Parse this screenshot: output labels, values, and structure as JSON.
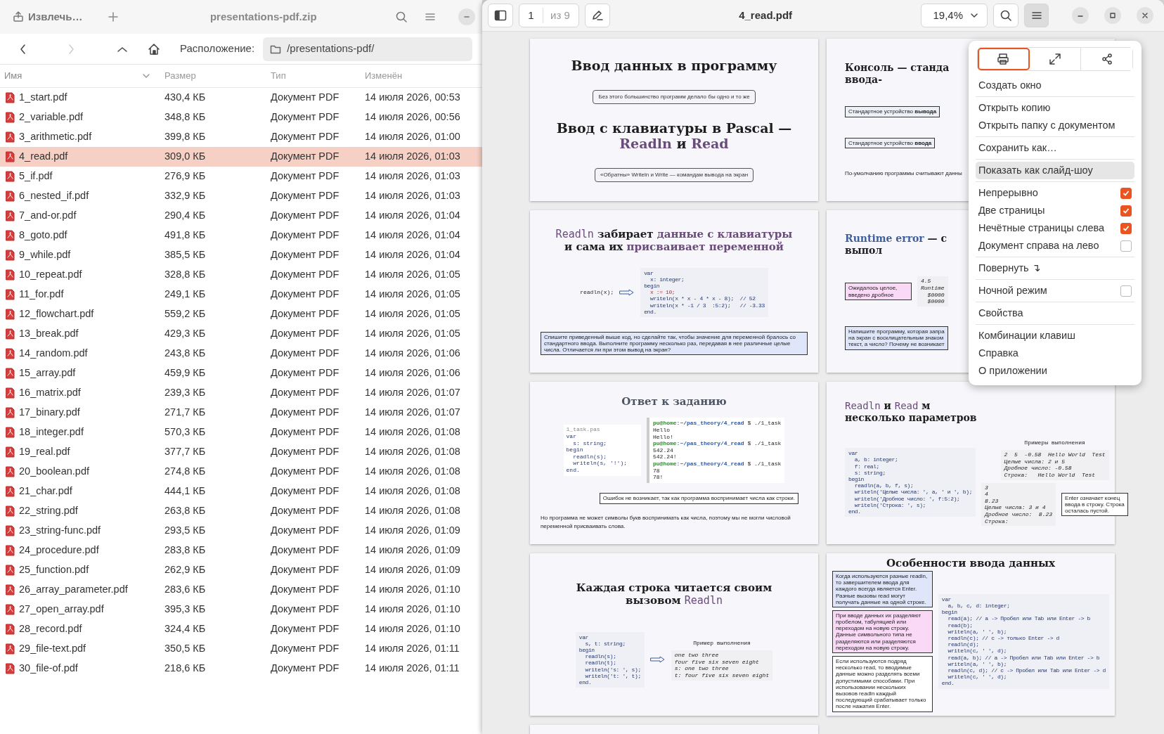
{
  "archive_window": {
    "extract_button": "Извлечь…",
    "title": "presentations-pdf.zip",
    "nav": {
      "back_disabled": false,
      "forward_disabled": true
    },
    "location_label": "Расположение:",
    "location_path": "/presentations-pdf/",
    "columns": [
      {
        "label": "Имя",
        "sorted": true
      },
      {
        "label": "Размер",
        "sorted": false
      },
      {
        "label": "Тип",
        "sorted": false
      },
      {
        "label": "Изменён",
        "sorted": false
      }
    ],
    "files": [
      {
        "name": "1_start.pdf",
        "size": "430,4 КБ",
        "type": "Документ PDF",
        "modified": "14 июля 2026, 00:53",
        "selected": false
      },
      {
        "name": "2_variable.pdf",
        "size": "348,8 КБ",
        "type": "Документ PDF",
        "modified": "14 июля 2026, 00:56",
        "selected": false
      },
      {
        "name": "3_arithmetic.pdf",
        "size": "399,8 КБ",
        "type": "Документ PDF",
        "modified": "14 июля 2026, 01:00",
        "selected": false
      },
      {
        "name": "4_read.pdf",
        "size": "309,0 КБ",
        "type": "Документ PDF",
        "modified": "14 июля 2026, 01:03",
        "selected": true
      },
      {
        "name": "5_if.pdf",
        "size": "276,9 КБ",
        "type": "Документ PDF",
        "modified": "14 июля 2026, 01:03",
        "selected": false
      },
      {
        "name": "6_nested_if.pdf",
        "size": "332,9 КБ",
        "type": "Документ PDF",
        "modified": "14 июля 2026, 01:03",
        "selected": false
      },
      {
        "name": "7_and-or.pdf",
        "size": "290,4 КБ",
        "type": "Документ PDF",
        "modified": "14 июля 2026, 01:04",
        "selected": false
      },
      {
        "name": "8_goto.pdf",
        "size": "491,8 КБ",
        "type": "Документ PDF",
        "modified": "14 июля 2026, 01:04",
        "selected": false
      },
      {
        "name": "9_while.pdf",
        "size": "385,5 КБ",
        "type": "Документ PDF",
        "modified": "14 июля 2026, 01:04",
        "selected": false
      },
      {
        "name": "10_repeat.pdf",
        "size": "328,8 КБ",
        "type": "Документ PDF",
        "modified": "14 июля 2026, 01:05",
        "selected": false
      },
      {
        "name": "11_for.pdf",
        "size": "249,1 КБ",
        "type": "Документ PDF",
        "modified": "14 июля 2026, 01:05",
        "selected": false
      },
      {
        "name": "12_flowchart.pdf",
        "size": "559,2 КБ",
        "type": "Документ PDF",
        "modified": "14 июля 2026, 01:05",
        "selected": false
      },
      {
        "name": "13_break.pdf",
        "size": "429,3 КБ",
        "type": "Документ PDF",
        "modified": "14 июля 2026, 01:05",
        "selected": false
      },
      {
        "name": "14_random.pdf",
        "size": "243,8 КБ",
        "type": "Документ PDF",
        "modified": "14 июля 2026, 01:06",
        "selected": false
      },
      {
        "name": "15_array.pdf",
        "size": "459,9 КБ",
        "type": "Документ PDF",
        "modified": "14 июля 2026, 01:06",
        "selected": false
      },
      {
        "name": "16_matrix.pdf",
        "size": "239,3 КБ",
        "type": "Документ PDF",
        "modified": "14 июля 2026, 01:07",
        "selected": false
      },
      {
        "name": "17_binary.pdf",
        "size": "271,7 КБ",
        "type": "Документ PDF",
        "modified": "14 июля 2026, 01:07",
        "selected": false
      },
      {
        "name": "18_integer.pdf",
        "size": "570,3 КБ",
        "type": "Документ PDF",
        "modified": "14 июля 2026, 01:08",
        "selected": false
      },
      {
        "name": "19_real.pdf",
        "size": "377,7 КБ",
        "type": "Документ PDF",
        "modified": "14 июля 2026, 01:08",
        "selected": false
      },
      {
        "name": "20_boolean.pdf",
        "size": "274,8 КБ",
        "type": "Документ PDF",
        "modified": "14 июля 2026, 01:08",
        "selected": false
      },
      {
        "name": "21_char.pdf",
        "size": "444,1 КБ",
        "type": "Документ PDF",
        "modified": "14 июля 2026, 01:08",
        "selected": false
      },
      {
        "name": "22_string.pdf",
        "size": "263,8 КБ",
        "type": "Документ PDF",
        "modified": "14 июля 2026, 01:08",
        "selected": false
      },
      {
        "name": "23_string-func.pdf",
        "size": "293,5 КБ",
        "type": "Документ PDF",
        "modified": "14 июля 2026, 01:09",
        "selected": false
      },
      {
        "name": "24_procedure.pdf",
        "size": "283,8 КБ",
        "type": "Документ PDF",
        "modified": "14 июля 2026, 01:09",
        "selected": false
      },
      {
        "name": "25_function.pdf",
        "size": "262,9 КБ",
        "type": "Документ PDF",
        "modified": "14 июля 2026, 01:09",
        "selected": false
      },
      {
        "name": "26_array_parameter.pdf",
        "size": "283,6 КБ",
        "type": "Документ PDF",
        "modified": "14 июля 2026, 01:10",
        "selected": false
      },
      {
        "name": "27_open_array.pdf",
        "size": "395,3 КБ",
        "type": "Документ PDF",
        "modified": "14 июля 2026, 01:10",
        "selected": false
      },
      {
        "name": "28_record.pdf",
        "size": "324,4 КБ",
        "type": "Документ PDF",
        "modified": "14 июля 2026, 01:10",
        "selected": false
      },
      {
        "name": "29_file-text.pdf",
        "size": "350,5 КБ",
        "type": "Документ PDF",
        "modified": "14 июля 2026, 01:11",
        "selected": false
      },
      {
        "name": "30_file-of.pdf",
        "size": "218,6 КБ",
        "type": "Документ PDF",
        "modified": "14 июля 2026, 01:11",
        "selected": false
      }
    ]
  },
  "viewer_window": {
    "page_number": "1",
    "page_count": "из 9",
    "title": "4_read.pdf",
    "zoom": "19,4%",
    "pages": [
      {
        "items": [
          {
            "kind": "heading",
            "lines": [
              [
                {
                  "text": "Ввод данных в программу"
                }
              ]
            ]
          },
          {
            "kind": "note",
            "text": "Без этого большинство программ делало бы одно и то же"
          },
          {
            "kind": "heading",
            "lines": [
              [
                {
                  "text": "Ввод с клавиатуры в Pascal —"
                }
              ],
              [
                {
                  "text": "Readln",
                  "color": "#6b4b7c"
                },
                {
                  "text": " и "
                },
                {
                  "text": "Read",
                  "color": "#6b4b7c"
                }
              ]
            ]
          },
          {
            "kind": "note",
            "text": "«Обратны» Writeln и Write — командам вывода на экран"
          }
        ]
      },
      {
        "items": [
          {
            "kind": "title",
            "lines": [
              [
                {
                  "text": "Консоль — станда"
                }
              ],
              [
                {
                  "text": "ввода-"
                }
              ]
            ]
          },
          {
            "kind": "box",
            "color": "#eef0f8",
            "text": "Стандартное устройство **вывода**"
          },
          {
            "kind": "box",
            "color": "#eef0f8",
            "text": "Стандартное устройство **ввода**"
          },
          {
            "kind": "text",
            "text": "По-умолчанию программы считывают данны"
          }
        ]
      },
      {
        "items": [
          {
            "kind": "title",
            "lines": [
              [
                {
                  "text": "Readln",
                  "color": "#6b4b7c",
                  "mono": true
                },
                {
                  "text": " забирает "
                },
                {
                  "text": "данные с клавиатуры",
                  "color": "#6b4b7c"
                }
              ],
              [
                {
                  "text": "и сама их "
                },
                {
                  "text": "присваивает переменной",
                  "color": "#6b4b7c"
                }
              ]
            ]
          },
          {
            "kind": "columns",
            "columns": [
              [
                {
                  "kind": "label",
                  "text": "readln(x);"
                }
              ],
              [
                {
                  "kind": "arrow"
                }
              ],
              [
                {
                  "kind": "code",
                  "lines": [
                    "var",
                    "  x: integer;",
                    "begin",
                    {
                      "text": "  x := 10;",
                      "struck": true
                    },
                    "  writeln(x * x - 4 * x - 8);  // 52",
                    "  writeln(x * -1 / 3  :5:2);   // -3.33",
                    "end."
                  ]
                }
              ]
            ]
          },
          {
            "kind": "box",
            "color": "#dfe6fa",
            "text": "Спишите приведенный выше код, но сделайте так, чтобы значение для переменной бралось со стандартного ввода. Выполните программу несколько раз, передавая в нее различные целые числа. Отличается ли при этом вывод на экран?"
          }
        ]
      },
      {
        "items": [
          {
            "kind": "title",
            "lines": [
              [
                {
                  "text": "Runtime error",
                  "color": "#40609a"
                },
                {
                  "text": " — с"
                }
              ],
              [
                {
                  "text": "выпол"
                }
              ]
            ]
          },
          {
            "kind": "columns",
            "columns": [
              [
                {
                  "kind": "box",
                  "color": "#f9d9f6",
                  "text": "Ожидалось целое, введено дробное"
                }
              ],
              [
                {
                  "kind": "output",
                  "lines": [
                    "4.5",
                    "Runtime",
                    "  $0000",
                    "  $0000"
                  ]
                }
              ]
            ]
          },
          {
            "kind": "box",
            "color": "#dfe6fa",
            "lines": [
              "Напишите программу, которая запра",
              "на экран с восклицательным знаком",
              "текст, а число? Почему не возникает"
            ]
          }
        ]
      },
      {
        "items": [
          {
            "kind": "title",
            "lines": [
              [
                {
                  "text": "Ответ к заданию",
                  "color": "#4d5563"
                }
              ]
            ]
          },
          {
            "kind": "columns",
            "columns": [
              [
                {
                  "kind": "editor",
                  "tab": "1_task.pas",
                  "lines": [
                    "var",
                    "  s: string;",
                    "begin",
                    "  readln(s);",
                    "  writeln(s, '!');",
                    "end."
                  ]
                }
              ],
              [
                {
                  "kind": "terminal",
                  "lines": [
                    {
                      "kind": "prompt",
                      "host": "pu@home",
                      "path": ":~/pas_theory/4_read",
                      "command": "$ ./1_task"
                    },
                    "Hello",
                    "Hello!",
                    {
                      "kind": "prompt",
                      "host": "pu@home",
                      "path": ":~/pas_theory/4_read",
                      "command": "$ ./1_task"
                    },
                    "542.24",
                    "542.24!",
                    {
                      "kind": "prompt",
                      "host": "pu@home",
                      "path": ":~/pas_theory/4_read",
                      "command": "$ ./1_task"
                    },
                    "78",
                    "78!"
                  ]
                }
              ]
            ]
          },
          {
            "kind": "callout",
            "color": "#ffffff",
            "text": "Ошибок не возникает, так как программа воспринимает числа как строки."
          },
          {
            "kind": "text",
            "text": "Но программа не может символы букв воспринимать как числа, поэтому мы не могли числовой переменной присваивать слова."
          }
        ]
      },
      {
        "items": [
          {
            "kind": "title",
            "lines": [
              [
                {
                  "text": "Readln",
                  "color": "#6b4b7c",
                  "mono": true
                },
                {
                  "text": " и "
                },
                {
                  "text": "Read",
                  "color": "#6b4b7c",
                  "mono": true
                },
                {
                  "text": " м"
                }
              ],
              [
                {
                  "text": "несколько параметров"
                }
              ]
            ]
          },
          {
            "kind": "columns",
            "columns": [
              [
                {
                  "kind": "code",
                  "lines": [
                    "var",
                    "  a, b: integer;",
                    "  f: real;",
                    "  s: string;",
                    "begin",
                    "  readln(a, b, f, s);",
                    "  writeln('Целые числа: ', a, ' и ', b);",
                    "  writeln('Дробное число: ', f:5:2);",
                    "  writeln('Строка: ', s);",
                    "end."
                  ]
                }
              ],
              [
                {
                  "kind": "label",
                  "text": "Примеры выполнения"
                },
                {
                  "kind": "output",
                  "lines": [
                    "2  5  -0.58  Hello World  Test",
                    "Целые числа: 2 и 5",
                    "Дробное число: -0.58",
                    "Строка:   Hello World  Test"
                  ]
                },
                {
                  "kind": "columns",
                  "columns": [
                    [
                      {
                        "kind": "output",
                        "lines": [
                          "3",
                          "4",
                          "8.23",
                          "Целые числа: 3 и 4",
                          "Дробное число:  8.23",
                          "Строка:"
                        ]
                      }
                    ],
                    [
                      {
                        "kind": "box",
                        "color": "#ffffff",
                        "text": "Enter означает конец ввода в строку. Строка осталась пустой."
                      }
                    ]
                  ]
                }
              ]
            ]
          }
        ]
      },
      {
        "items": [
          {
            "kind": "title",
            "lines": [
              [
                {
                  "text": "Каждая строка читается своим"
                }
              ],
              [
                {
                  "text": "вызовом "
                },
                {
                  "text": "Readln",
                  "color": "#6b4b7c",
                  "mono": true
                }
              ]
            ]
          },
          {
            "kind": "columns",
            "columns": [
              [
                {
                  "kind": "code",
                  "lines": [
                    "var",
                    "  s, t: string;",
                    "begin",
                    "  readln(s);",
                    "  readln(t);",
                    "  writeln('s: ', s);",
                    "  writeln('t: ', t);",
                    "end."
                  ]
                }
              ],
              [
                {
                  "kind": "arrow"
                }
              ],
              [
                {
                  "kind": "label",
                  "text": "Пример выполнения"
                },
                {
                  "kind": "output",
                  "lines": [
                    "one two three",
                    "four five six seven eight",
                    "s: one two three",
                    "t: four five six seven eight"
                  ]
                }
              ]
            ]
          }
        ]
      },
      {
        "items": [
          {
            "kind": "title",
            "lines": [
              [
                {
                  "text": "Особенности ввода данных"
                }
              ]
            ]
          },
          {
            "kind": "columns",
            "columns": [
              [
                {
                  "kind": "box",
                  "color": "#dfe6fa",
                  "text": "Когда используются разные readln, то завершителем ввода для каждого всегда является Enter. Разные вызовы read могут получать данные на одной строке."
                },
                {
                  "kind": "box",
                  "color": "#f9d9f6",
                  "text": "При вводе данных их разделяют пробелом, табуляцией или переходом на новую строку. Данные символьного типа не разделяются или разделяются переходом на новую строку."
                },
                {
                  "kind": "box",
                  "color": "#ffffff",
                  "text": "Если используются подряд несколько read, то вводимые данные можно разделять всеми допустимыми способами. При использовании нескольких вызовов readln каждый последующий срабатывает только после нажатия Enter."
                }
              ],
              [
                {
                  "kind": "code",
                  "lines": [
                    "var",
                    "  a, b, c, d: integer;",
                    "begin",
                    "  read(a); // a -> Пробел или Tab или Enter -> b",
                    "  read(b);",
                    "  writeln(a, ' ', b);",
                    "  readln(c); // c -> только Enter -> d",
                    "  readln(d);",
                    "  writeln(c, ' ', d);",
                    "  read(a, b); // a -> Пробел или Tab или Enter -> b",
                    "  writeln(a, ' ', b);",
                    "  readln(c, d); // c -> Пробел или Tab или Enter -> d",
                    "  writeln(c, ' ', d);",
                    "end."
                  ]
                }
              ]
            ]
          }
        ]
      }
    ],
    "menu": {
      "icon_buttons": [
        {
          "kind": "print",
          "selected": true
        },
        {
          "kind": "fullscreen",
          "selected": false
        },
        {
          "kind": "share",
          "selected": false
        }
      ],
      "groups": [
        [
          {
            "kind": "item",
            "label": "Создать окно",
            "hovered": false
          }
        ],
        [
          {
            "kind": "item",
            "label": "Открыть копию",
            "hovered": false
          },
          {
            "kind": "item",
            "label": "Открыть папку с документом",
            "hovered": false
          }
        ],
        [
          {
            "kind": "item",
            "label": "Сохранить как…",
            "hovered": false
          }
        ],
        [
          {
            "kind": "item",
            "label": "Показать как слайд-шоу",
            "hovered": true
          }
        ],
        [
          {
            "kind": "check",
            "label": "Непрерывно",
            "checked": true,
            "hovered": false
          },
          {
            "kind": "check",
            "label": "Две страницы",
            "checked": true,
            "hovered": false
          },
          {
            "kind": "check",
            "label": "Нечётные страницы слева",
            "checked": true,
            "hovered": false
          },
          {
            "kind": "check",
            "label": "Документ справа на лево",
            "checked": false,
            "hovered": false
          }
        ],
        [
          {
            "kind": "item",
            "label": "Повернуть ↴",
            "hovered": false
          }
        ],
        [
          {
            "kind": "check",
            "label": "Ночной режим",
            "checked": false,
            "hovered": false
          }
        ],
        [
          {
            "kind": "item",
            "label": "Свойства",
            "hovered": false
          }
        ],
        [
          {
            "kind": "item",
            "label": "Комбинации клавиш",
            "hovered": false
          },
          {
            "kind": "item",
            "label": "Справка",
            "hovered": false
          },
          {
            "kind": "item",
            "label": "О приложении",
            "hovered": false
          }
        ]
      ]
    }
  }
}
